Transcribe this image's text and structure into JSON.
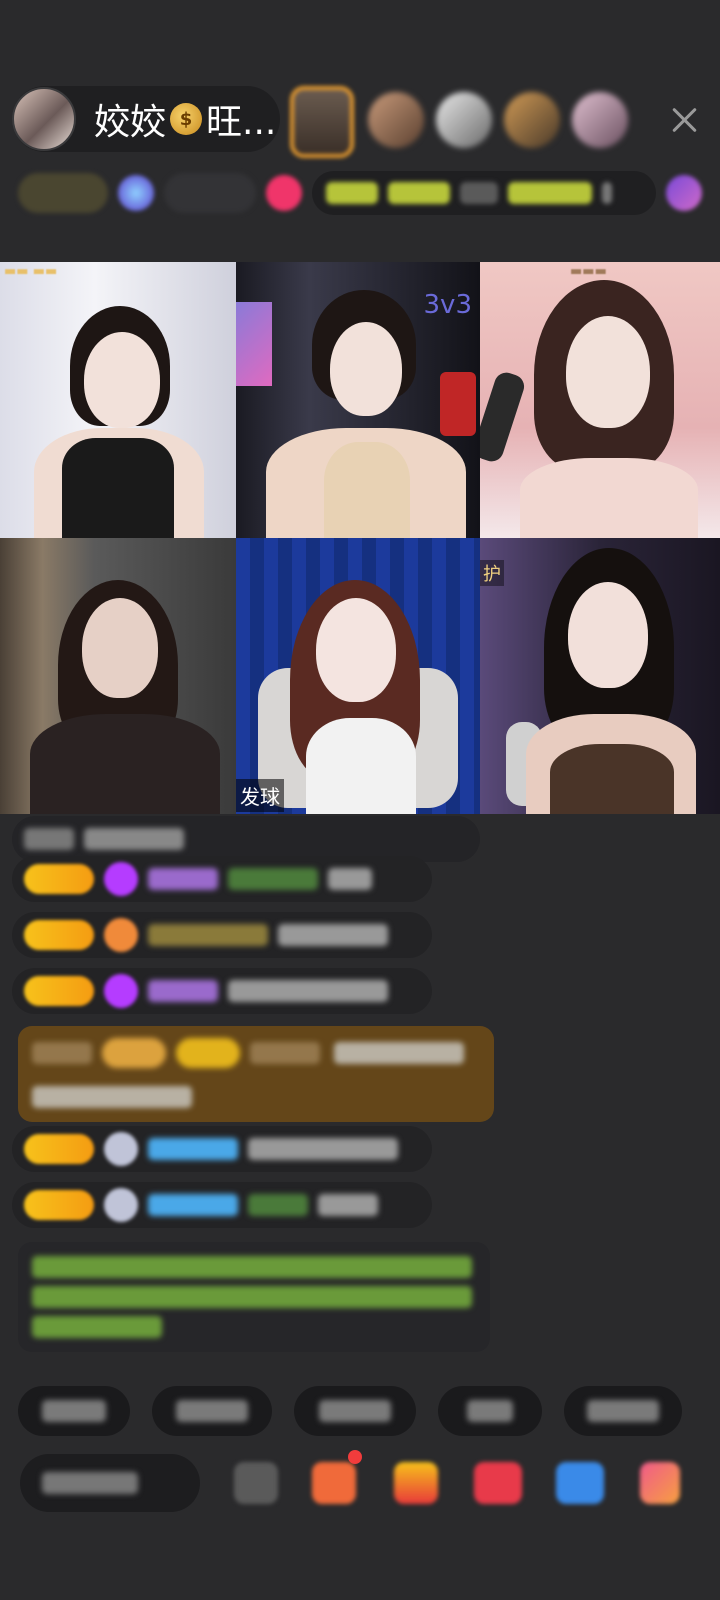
{
  "header": {
    "host_name": "姣姣",
    "host_name_suffix": "旺...",
    "money_icon": "money-bag-icon"
  },
  "video_tiles": [
    {
      "mode_label": "",
      "bottom_label": ""
    },
    {
      "mode_label": "3v3",
      "bottom_label": ""
    },
    {
      "mode_label": "",
      "bottom_label": ""
    },
    {
      "mode_label": "",
      "bottom_label": ""
    },
    {
      "mode_label": "",
      "bottom_label": "发球"
    },
    {
      "mode_label": "",
      "bottom_label": ""
    }
  ],
  "side_label": "护",
  "colors": {
    "background": "#2a2a2c",
    "badge_yellow": "#f7c21b",
    "gem_purple": "#b53cff",
    "chat_green": "#8fd14f",
    "username_blue": "#4aa8e8",
    "system_brown": "#6b4a18"
  }
}
